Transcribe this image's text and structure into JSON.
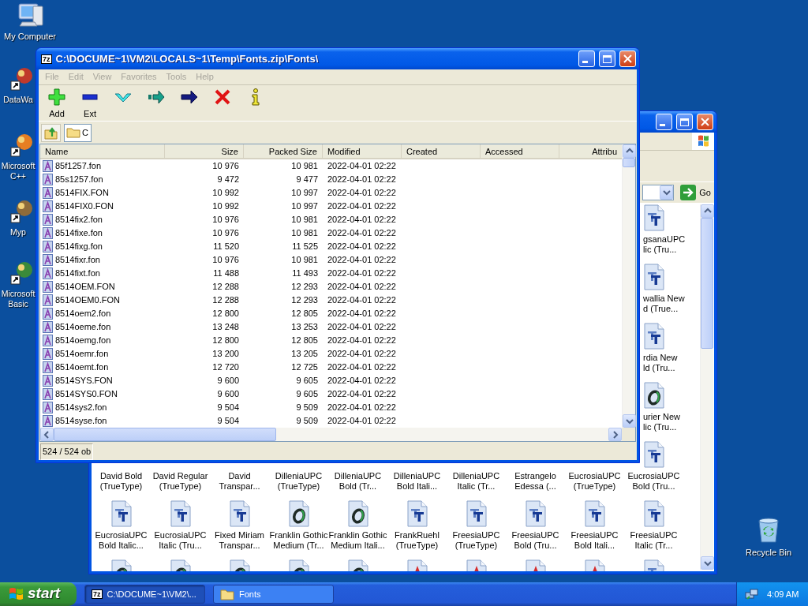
{
  "desktop_icons": [
    {
      "kind": "computer",
      "lines": [
        "My Computer"
      ]
    },
    {
      "kind": "shortcut",
      "lines": [
        "DataWa"
      ]
    },
    {
      "kind": "shortcut",
      "lines": [
        "Microsoft",
        "C++"
      ]
    },
    {
      "kind": "shortcut",
      "lines": [
        "Myp"
      ]
    },
    {
      "kind": "shortcut",
      "lines": [
        "Microsoft",
        "Basic"
      ]
    },
    {
      "kind": "recycle-bin",
      "lines": [
        "Recycle Bin"
      ]
    }
  ],
  "fonts_window": {
    "go_button": "Go",
    "icon_rows": [
      {
        "items": [
          {
            "kind": "truetype",
            "lines": [
              "gsanaUPC",
              "lic (Tru..."
            ]
          }
        ]
      },
      {
        "items": [
          {
            "kind": "truetype",
            "lines": [
              "wallia New",
              "d (True..."
            ]
          }
        ]
      },
      {
        "items": [
          {
            "kind": "truetype",
            "lines": [
              "rdia New",
              "ld (Tru..."
            ]
          }
        ]
      },
      {
        "items": [
          {
            "kind": "opentype",
            "lines": [
              "urier New",
              "lic (Tru..."
            ]
          }
        ]
      },
      {
        "items": [
          {
            "lines": [
              "David Bold",
              "(TrueType)"
            ]
          },
          {
            "lines": [
              "David Regular",
              "(TrueType)"
            ]
          },
          {
            "lines": [
              "David",
              "Transpar..."
            ]
          },
          {
            "lines": [
              "DilleniaUPC",
              "(TrueType)"
            ]
          },
          {
            "lines": [
              "DilleniaUPC",
              "Bold (Tr..."
            ]
          },
          {
            "lines": [
              "DilleniaUPC",
              "Bold Itali..."
            ]
          },
          {
            "lines": [
              "DilleniaUPC",
              "Italic (Tr..."
            ]
          },
          {
            "lines": [
              "Estrangelo",
              "Edessa (..."
            ]
          },
          {
            "lines": [
              "EucrosiaUPC",
              "(TrueType)"
            ]
          },
          {
            "kind": "truetype",
            "lines": [
              "EucrosiaUPC",
              "Bold (Tru..."
            ]
          }
        ]
      },
      {
        "items": [
          {
            "kind": "truetype",
            "lines": [
              "EucrosiaUPC",
              "Bold Italic..."
            ]
          },
          {
            "kind": "truetype",
            "lines": [
              "EucrosiaUPC",
              "Italic (Tru..."
            ]
          },
          {
            "kind": "truetype",
            "lines": [
              "Fixed Miriam",
              "Transpar..."
            ]
          },
          {
            "kind": "opentype",
            "lines": [
              "Franklin Gothic",
              "Medium (Tr..."
            ]
          },
          {
            "kind": "opentype",
            "lines": [
              "Franklin Gothic",
              "Medium Itali..."
            ]
          },
          {
            "kind": "truetype",
            "lines": [
              "FrankRuehl",
              "(TrueType)"
            ]
          },
          {
            "kind": "truetype",
            "lines": [
              "FreesiaUPC",
              "(TrueType)"
            ]
          },
          {
            "kind": "truetype",
            "lines": [
              "FreesiaUPC",
              "Bold (Tru..."
            ]
          },
          {
            "kind": "truetype",
            "lines": [
              "FreesiaUPC",
              "Bold Itali..."
            ]
          },
          {
            "kind": "truetype",
            "lines": [
              "FreesiaUPC",
              "Italic (Tr..."
            ]
          }
        ]
      },
      {
        "items": [
          {
            "kind": "opentype"
          },
          {
            "kind": "opentype"
          },
          {
            "kind": "opentype"
          },
          {
            "kind": "opentype"
          },
          {
            "kind": "opentype"
          },
          {
            "kind": "raster"
          },
          {
            "kind": "raster"
          },
          {
            "kind": "raster"
          },
          {
            "kind": "raster"
          },
          {
            "kind": "truetype"
          }
        ]
      }
    ]
  },
  "archive_window": {
    "icon_text": "7z",
    "title": "C:\\DOCUME~1\\VM2\\LOCALS~1\\Temp\\Fonts.zip\\Fonts\\",
    "menu": [
      {
        "label": "File",
        "disabled": true
      },
      {
        "label": "Edit",
        "disabled": true
      },
      {
        "label": "View",
        "disabled": true
      },
      {
        "label": "Favorites",
        "disabled": true
      },
      {
        "label": "Tools",
        "disabled": true
      },
      {
        "label": "Help",
        "disabled": true
      }
    ],
    "toolbar": [
      {
        "kind": "add",
        "label": "Add"
      },
      {
        "kind": "extract",
        "label": "Ext"
      },
      {
        "kind": "test"
      },
      {
        "kind": "copy"
      },
      {
        "kind": "move"
      },
      {
        "kind": "delete"
      },
      {
        "kind": "info"
      }
    ],
    "path": "C",
    "columns": [
      "Name",
      "Size",
      "Packed Size",
      "Modified",
      "Created",
      "Accessed",
      "Attribu"
    ],
    "rows": [
      {
        "name": "85f1257.fon",
        "size": "10 976",
        "packed_size": "10 981",
        "modified": "2022-04-01 02:22"
      },
      {
        "name": "85s1257.fon",
        "size": "9 472",
        "packed_size": "9 477",
        "modified": "2022-04-01 02:22"
      },
      {
        "name": "8514FIX.FON",
        "size": "10 992",
        "packed_size": "10 997",
        "modified": "2022-04-01 02:22"
      },
      {
        "name": "8514FIX0.FON",
        "size": "10 992",
        "packed_size": "10 997",
        "modified": "2022-04-01 02:22"
      },
      {
        "name": "8514fix2.fon",
        "size": "10 976",
        "packed_size": "10 981",
        "modified": "2022-04-01 02:22"
      },
      {
        "name": "8514fixe.fon",
        "size": "10 976",
        "packed_size": "10 981",
        "modified": "2022-04-01 02:22"
      },
      {
        "name": "8514fixg.fon",
        "size": "11 520",
        "packed_size": "11 525",
        "modified": "2022-04-01 02:22"
      },
      {
        "name": "8514fixr.fon",
        "size": "10 976",
        "packed_size": "10 981",
        "modified": "2022-04-01 02:22"
      },
      {
        "name": "8514fixt.fon",
        "size": "11 488",
        "packed_size": "11 493",
        "modified": "2022-04-01 02:22"
      },
      {
        "name": "8514OEM.FON",
        "size": "12 288",
        "packed_size": "12 293",
        "modified": "2022-04-01 02:22"
      },
      {
        "name": "8514OEM0.FON",
        "size": "12 288",
        "packed_size": "12 293",
        "modified": "2022-04-01 02:22"
      },
      {
        "name": "8514oem2.fon",
        "size": "12 800",
        "packed_size": "12 805",
        "modified": "2022-04-01 02:22"
      },
      {
        "name": "8514oeme.fon",
        "size": "13 248",
        "packed_size": "13 253",
        "modified": "2022-04-01 02:22"
      },
      {
        "name": "8514oemg.fon",
        "size": "12 800",
        "packed_size": "12 805",
        "modified": "2022-04-01 02:22"
      },
      {
        "name": "8514oemr.fon",
        "size": "13 200",
        "packed_size": "13 205",
        "modified": "2022-04-01 02:22"
      },
      {
        "name": "8514oemt.fon",
        "size": "12 720",
        "packed_size": "12 725",
        "modified": "2022-04-01 02:22"
      },
      {
        "name": "8514SYS.FON",
        "size": "9 600",
        "packed_size": "9 605",
        "modified": "2022-04-01 02:22"
      },
      {
        "name": "8514SYS0.FON",
        "size": "9 600",
        "packed_size": "9 605",
        "modified": "2022-04-01 02:22"
      },
      {
        "name": "8514sys2.fon",
        "size": "9 504",
        "packed_size": "9 509",
        "modified": "2022-04-01 02:22"
      },
      {
        "name": "8514syse.fon",
        "size": "9 504",
        "packed_size": "9 509",
        "modified": "2022-04-01 02:22"
      }
    ],
    "status": "524 / 524 ob"
  },
  "taskbar": {
    "start": "start",
    "tasks": [
      {
        "kind": "archive",
        "icon_text": "7z",
        "label": "C:\\DOCUME~1\\VM2\\...",
        "selected": true
      },
      {
        "kind": "folder",
        "label": "Fonts",
        "selected": false
      }
    ],
    "clock": "4:09 AM"
  }
}
